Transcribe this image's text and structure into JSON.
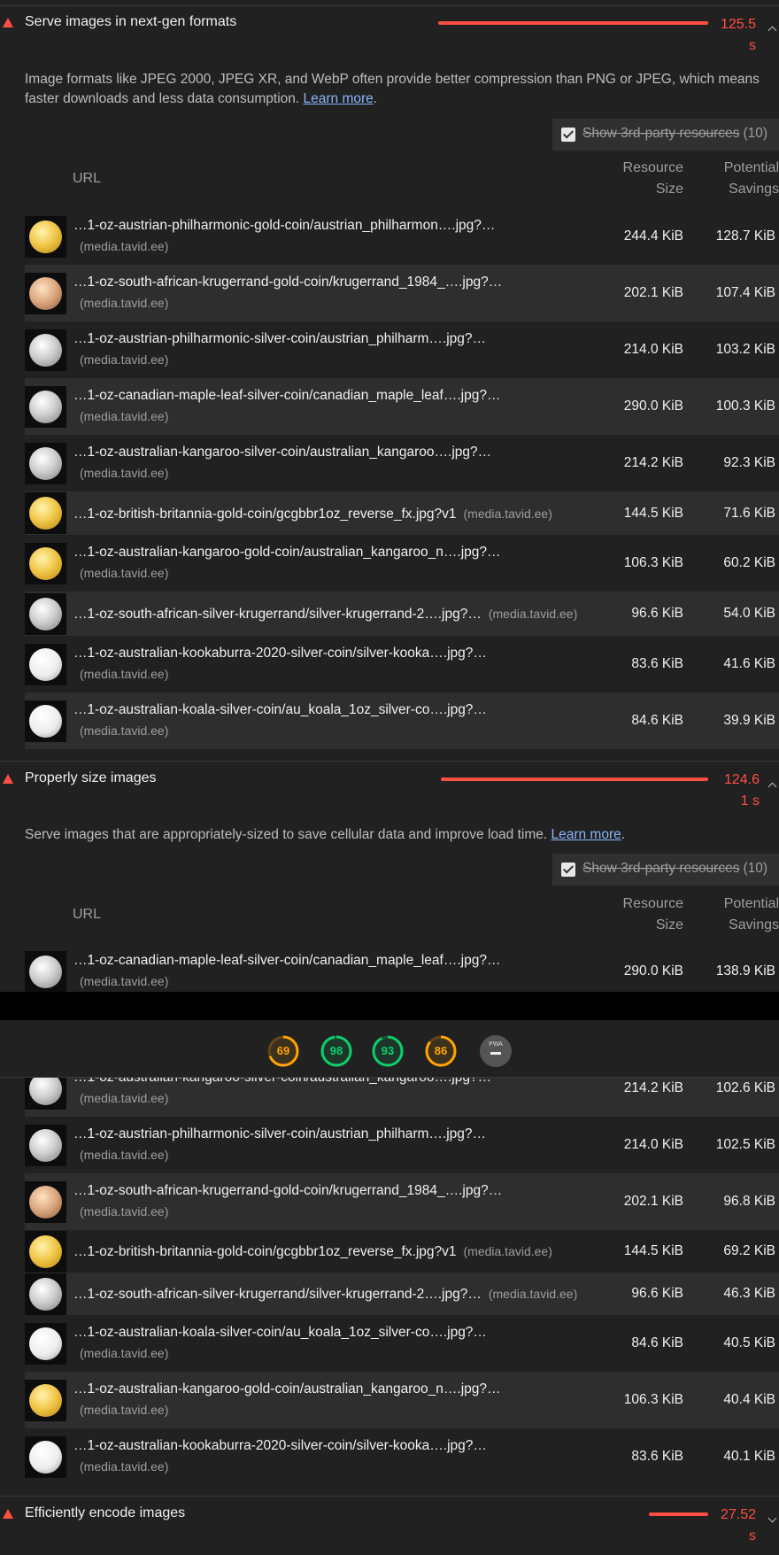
{
  "colors": {
    "fail": "#ff4e42",
    "average": "#ffa400",
    "pass": "#0cce6b",
    "link": "#8ab4f8"
  },
  "audit1": {
    "title": "Serve images in next-gen formats",
    "savings_line1": "125.5",
    "savings_line2": "s",
    "bar_fraction": 1.0,
    "description": "Image formats like JPEG 2000, JPEG XR, and WebP often provide better compression than PNG or JPEG, which means faster downloads and less data consumption.",
    "learn_more": "Learn more",
    "filter_label": "Show 3rd-party resources",
    "filter_count": "(10)",
    "col_url": "URL",
    "col_size_1": "Resource",
    "col_size_2": "Size",
    "col_savings_1": "Potential",
    "col_savings_2": "Savings",
    "rows": [
      {
        "url": "…1-oz-austrian-philharmonic-gold-coin/austrian_philharmon….jpg?…",
        "host": "(media.tavid.ee)",
        "size": "244.4 KiB",
        "savings": "128.7 KiB",
        "thumb": "gold"
      },
      {
        "url": "…1-oz-south-african-krugerrand-gold-coin/krugerrand_1984_….jpg?…",
        "host": "(media.tavid.ee)",
        "size": "202.1 KiB",
        "savings": "107.4 KiB",
        "thumb": "rose"
      },
      {
        "url": "…1-oz-austrian-philharmonic-silver-coin/austrian_philharm….jpg?…",
        "host": "(media.tavid.ee)",
        "size": "214.0 KiB",
        "savings": "103.2 KiB",
        "thumb": "silver"
      },
      {
        "url": "…1-oz-canadian-maple-leaf-silver-coin/canadian_maple_leaf….jpg?…",
        "host": "(media.tavid.ee)",
        "size": "290.0 KiB",
        "savings": "100.3 KiB",
        "thumb": "silver"
      },
      {
        "url": "…1-oz-australian-kangaroo-silver-coin/australian_kangaroo….jpg?…",
        "host": "(media.tavid.ee)",
        "size": "214.2 KiB",
        "savings": "92.3 KiB",
        "thumb": "silver"
      },
      {
        "url": "…1-oz-british-britannia-gold-coin/gcgbbr1oz_reverse_fx.jpg?v1",
        "host": "(media.tavid.ee)",
        "size": "144.5 KiB",
        "savings": "71.6 KiB",
        "thumb": "gold"
      },
      {
        "url": "…1-oz-australian-kangaroo-gold-coin/australian_kangaroo_n….jpg?…",
        "host": "(media.tavid.ee)",
        "size": "106.3 KiB",
        "savings": "60.2 KiB",
        "thumb": "gold"
      },
      {
        "url": "…1-oz-south-african-silver-krugerrand/silver-krugerrand-2….jpg?…",
        "host": "(media.tavid.ee)",
        "size": "96.6 KiB",
        "savings": "54.0 KiB",
        "thumb": "silver"
      },
      {
        "url": "…1-oz-australian-kookaburra-2020-silver-coin/silver-kooka….jpg?…",
        "host": "(media.tavid.ee)",
        "size": "83.6 KiB",
        "savings": "41.6 KiB",
        "thumb": "white"
      },
      {
        "url": "…1-oz-australian-koala-silver-coin/au_koala_1oz_silver-co….jpg?…",
        "host": "(media.tavid.ee)",
        "size": "84.6 KiB",
        "savings": "39.9 KiB",
        "thumb": "white"
      }
    ]
  },
  "audit2": {
    "title": "Properly size images",
    "savings_line1": "124.6",
    "savings_line2": "1 s",
    "bar_fraction": 0.99,
    "description": "Serve images that are appropriately-sized to save cellular data and improve load time.",
    "learn_more": "Learn more",
    "filter_label": "Show 3rd-party resources",
    "filter_count": "(10)",
    "col_url": "URL",
    "col_size_1": "Resource",
    "col_size_2": "Size",
    "col_savings_1": "Potential",
    "col_savings_2": "Savings",
    "rows": [
      {
        "url": "…1-oz-canadian-maple-leaf-silver-coin/canadian_maple_leaf….jpg?…",
        "host": "(media.tavid.ee)",
        "size": "290.0 KiB",
        "savings": "138.9 KiB",
        "thumb": "silver"
      },
      {
        "url": "…1-oz-australian-kangaroo-silver-coin/australian_kangaroo….jpg?…",
        "host": "(media.tavid.ee)",
        "size": "214.2 KiB",
        "savings": "102.6 KiB",
        "thumb": "silver"
      },
      {
        "url": "…1-oz-austrian-philharmonic-silver-coin/austrian_philharm….jpg?…",
        "host": "(media.tavid.ee)",
        "size": "214.0 KiB",
        "savings": "102.5 KiB",
        "thumb": "silver"
      },
      {
        "url": "…1-oz-south-african-krugerrand-gold-coin/krugerrand_1984_….jpg?…",
        "host": "(media.tavid.ee)",
        "size": "202.1 KiB",
        "savings": "96.8 KiB",
        "thumb": "rose"
      },
      {
        "url": "…1-oz-british-britannia-gold-coin/gcgbbr1oz_reverse_fx.jpg?v1",
        "host": "(media.tavid.ee)",
        "size": "144.5 KiB",
        "savings": "69.2 KiB",
        "thumb": "gold"
      },
      {
        "url": "…1-oz-south-african-silver-krugerrand/silver-krugerrand-2….jpg?…",
        "host": "(media.tavid.ee)",
        "size": "96.6 KiB",
        "savings": "46.3 KiB",
        "thumb": "silver"
      },
      {
        "url": "…1-oz-australian-koala-silver-coin/au_koala_1oz_silver-co….jpg?…",
        "host": "(media.tavid.ee)",
        "size": "84.6 KiB",
        "savings": "40.5 KiB",
        "thumb": "white"
      },
      {
        "url": "…1-oz-australian-kangaroo-gold-coin/australian_kangaroo_n….jpg?…",
        "host": "(media.tavid.ee)",
        "size": "106.3 KiB",
        "savings": "40.4 KiB",
        "thumb": "gold"
      },
      {
        "url": "…1-oz-australian-kookaburra-2020-silver-coin/silver-kooka….jpg?…",
        "host": "(media.tavid.ee)",
        "size": "83.6 KiB",
        "savings": "40.1 KiB",
        "thumb": "white"
      }
    ]
  },
  "audit3": {
    "title": "Efficiently encode images",
    "savings_line1": "27.52",
    "savings_line2": "s",
    "bar_fraction": 0.22
  },
  "scores": [
    {
      "value": "69",
      "score": 0.69,
      "status": "average"
    },
    {
      "value": "98",
      "score": 0.98,
      "status": "pass"
    },
    {
      "value": "93",
      "score": 0.93,
      "status": "pass"
    },
    {
      "value": "86",
      "score": 0.86,
      "status": "average"
    }
  ],
  "pwa": {
    "label": "PWA"
  }
}
